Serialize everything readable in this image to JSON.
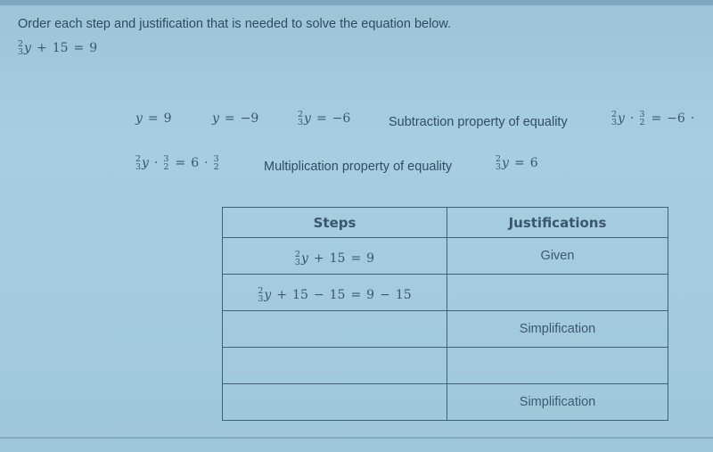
{
  "prompt": "Order each step and justification that is needed to solve the equation below.",
  "given_equation": {
    "frac_num": "2",
    "frac_den": "3",
    "var": "y",
    "rest": [
      "+",
      "15",
      "=",
      "9"
    ]
  },
  "answer_bank": [
    {
      "kind": "math",
      "text": [
        "y",
        "=",
        "9"
      ]
    },
    {
      "kind": "math",
      "text": [
        "y",
        "=",
        "−9"
      ]
    },
    {
      "kind": "frac-math",
      "frac_num": "2",
      "frac_den": "3",
      "var": "y",
      "rest": [
        "=",
        "−6"
      ]
    },
    {
      "kind": "text",
      "text": "Subtraction property of equality"
    },
    {
      "kind": "frac-math",
      "frac_num": "2",
      "frac_den": "3",
      "var": "y",
      "rest": [
        "·",
        "3/2",
        "=",
        "−6",
        "·"
      ]
    },
    {
      "kind": "frac-math",
      "frac_num": "2",
      "frac_den": "3",
      "var": "y",
      "rest": [
        "·",
        "3/2",
        "=",
        "6",
        "·",
        "3/2"
      ]
    },
    {
      "kind": "text",
      "text": "Multiplication property of equality"
    },
    {
      "kind": "frac-math",
      "frac_num": "2",
      "frac_den": "3",
      "var": "y",
      "rest": [
        "=",
        "6"
      ]
    }
  ],
  "table": {
    "headers": [
      "Steps",
      "Justifications"
    ],
    "rows": [
      {
        "step": {
          "frac_num": "2",
          "frac_den": "3",
          "var": "y",
          "rest": [
            "+",
            "15",
            "=",
            "9"
          ]
        },
        "justification": "Given"
      },
      {
        "step": {
          "frac_num": "2",
          "frac_den": "3",
          "var": "y",
          "rest": [
            "+",
            "15",
            "−",
            "15",
            "=",
            "9",
            "−",
            "15"
          ]
        },
        "justification": ""
      },
      {
        "step": null,
        "justification": "Simplification"
      },
      {
        "step": null,
        "justification": ""
      },
      {
        "step": null,
        "justification": "Simplification"
      }
    ]
  }
}
